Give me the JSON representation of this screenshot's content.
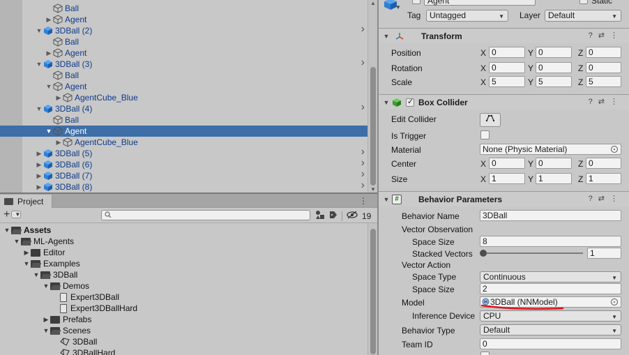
{
  "hierarchy": {
    "rows": [
      {
        "label": "Ball",
        "indent": 2,
        "arrow": "",
        "icon": "cube-outline",
        "chevron": false,
        "selected": false
      },
      {
        "label": "Agent",
        "indent": 2,
        "arrow": "▶",
        "icon": "cube-outline",
        "chevron": false,
        "selected": false
      },
      {
        "label": "3DBall (2)",
        "indent": 1,
        "arrow": "▼",
        "icon": "cube-prefab",
        "chevron": true,
        "selected": false
      },
      {
        "label": "Ball",
        "indent": 2,
        "arrow": "",
        "icon": "cube-outline",
        "chevron": false,
        "selected": false
      },
      {
        "label": "Agent",
        "indent": 2,
        "arrow": "▶",
        "icon": "cube-outline",
        "chevron": false,
        "selected": false
      },
      {
        "label": "3DBall (3)",
        "indent": 1,
        "arrow": "▼",
        "icon": "cube-prefab",
        "chevron": true,
        "selected": false
      },
      {
        "label": "Ball",
        "indent": 2,
        "arrow": "",
        "icon": "cube-outline",
        "chevron": false,
        "selected": false
      },
      {
        "label": "Agent",
        "indent": 2,
        "arrow": "▼",
        "icon": "cube-outline",
        "chevron": false,
        "selected": false
      },
      {
        "label": "AgentCube_Blue",
        "indent": 3,
        "arrow": "▶",
        "icon": "cube-outline",
        "chevron": false,
        "selected": false
      },
      {
        "label": "3DBall (4)",
        "indent": 1,
        "arrow": "▼",
        "icon": "cube-prefab",
        "chevron": true,
        "selected": false
      },
      {
        "label": "Ball",
        "indent": 2,
        "arrow": "",
        "icon": "cube-outline",
        "chevron": false,
        "selected": false
      },
      {
        "label": "Agent",
        "indent": 2,
        "arrow": "▼",
        "icon": "cube-outline",
        "chevron": false,
        "selected": true
      },
      {
        "label": "AgentCube_Blue",
        "indent": 3,
        "arrow": "▶",
        "icon": "cube-outline",
        "chevron": false,
        "selected": false
      },
      {
        "label": "3DBall (5)",
        "indent": 1,
        "arrow": "▶",
        "icon": "cube-prefab",
        "chevron": true,
        "selected": false
      },
      {
        "label": "3DBall (6)",
        "indent": 1,
        "arrow": "▶",
        "icon": "cube-prefab",
        "chevron": true,
        "selected": false
      },
      {
        "label": "3DBall (7)",
        "indent": 1,
        "arrow": "▶",
        "icon": "cube-prefab",
        "chevron": true,
        "selected": false
      },
      {
        "label": "3DBall (8)",
        "indent": 1,
        "arrow": "▶",
        "icon": "cube-prefab",
        "chevron": true,
        "selected": false
      }
    ]
  },
  "project": {
    "tab_label": "Project",
    "tab_icons": "⋮",
    "hidden_count": "19",
    "rows": [
      {
        "label": "Assets",
        "indent": 0,
        "arrow": "▼",
        "icon": "folder-open",
        "bold": true
      },
      {
        "label": "ML-Agents",
        "indent": 1,
        "arrow": "▼",
        "icon": "folder-open",
        "bold": false
      },
      {
        "label": "Editor",
        "indent": 2,
        "arrow": "▶",
        "icon": "folder",
        "bold": false
      },
      {
        "label": "Examples",
        "indent": 2,
        "arrow": "▼",
        "icon": "folder-open",
        "bold": false
      },
      {
        "label": "3DBall",
        "indent": 3,
        "arrow": "▼",
        "icon": "folder-open",
        "bold": false
      },
      {
        "label": "Demos",
        "indent": 4,
        "arrow": "▼",
        "icon": "folder-open",
        "bold": false
      },
      {
        "label": "Expert3DBall",
        "indent": 5,
        "arrow": "",
        "icon": "file",
        "bold": false
      },
      {
        "label": "Expert3DBallHard",
        "indent": 5,
        "arrow": "",
        "icon": "file",
        "bold": false
      },
      {
        "label": "Prefabs",
        "indent": 4,
        "arrow": "▶",
        "icon": "folder",
        "bold": false
      },
      {
        "label": "Scenes",
        "indent": 4,
        "arrow": "▼",
        "icon": "folder-open",
        "bold": false
      },
      {
        "label": "3DBall",
        "indent": 5,
        "arrow": "",
        "icon": "scene",
        "bold": false
      },
      {
        "label": "3DBallHard",
        "indent": 5,
        "arrow": "",
        "icon": "scene",
        "bold": false
      }
    ]
  },
  "inspector": {
    "object_name": "Agent",
    "static_label": "Static",
    "tag_label": "Tag",
    "tag_value": "Untagged",
    "layer_label": "Layer",
    "layer_value": "Default",
    "transform": {
      "title": "Transform",
      "position_label": "Position",
      "rotation_label": "Rotation",
      "scale_label": "Scale",
      "position": [
        "0",
        "0",
        "0"
      ],
      "rotation": [
        "0",
        "0",
        "0"
      ],
      "scale": [
        "5",
        "5",
        "5"
      ]
    },
    "box_collider": {
      "title": "Box Collider",
      "edit_collider_label": "Edit Collider",
      "is_trigger_label": "Is Trigger",
      "material_label": "Material",
      "material_value": "None (Physic Material)",
      "center_label": "Center",
      "size_label": "Size",
      "center": [
        "0",
        "0",
        "0"
      ],
      "size": [
        "1",
        "1",
        "1"
      ]
    },
    "behavior_parameters": {
      "title": "Behavior Parameters",
      "behavior_name_label": "Behavior Name",
      "behavior_name": "3DBall",
      "vector_observation_label": "Vector Observation",
      "space_size_label": "Space Size",
      "obs_space_size": "8",
      "stacked_vectors_label": "Stacked Vectors",
      "stacked_vectors": "1",
      "vector_action_label": "Vector Action",
      "space_type_label": "Space Type",
      "space_type": "Continuous",
      "action_space_size": "2",
      "model_label": "Model",
      "model_value": "3DBall (NNModel)",
      "inference_device_label": "Inference Device",
      "inference_device": "CPU",
      "behavior_type_label": "Behavior Type",
      "behavior_type": "Default",
      "team_id_label": "Team ID",
      "team_id": "0"
    },
    "axis_labels": [
      "X",
      "Y",
      "Z"
    ]
  },
  "colors": {
    "selection": "#3d6ea8",
    "hierarchy_text": "#0d3a8a",
    "prefab_icon": "#2f7fd8",
    "annotation_red": "#e0141e"
  }
}
